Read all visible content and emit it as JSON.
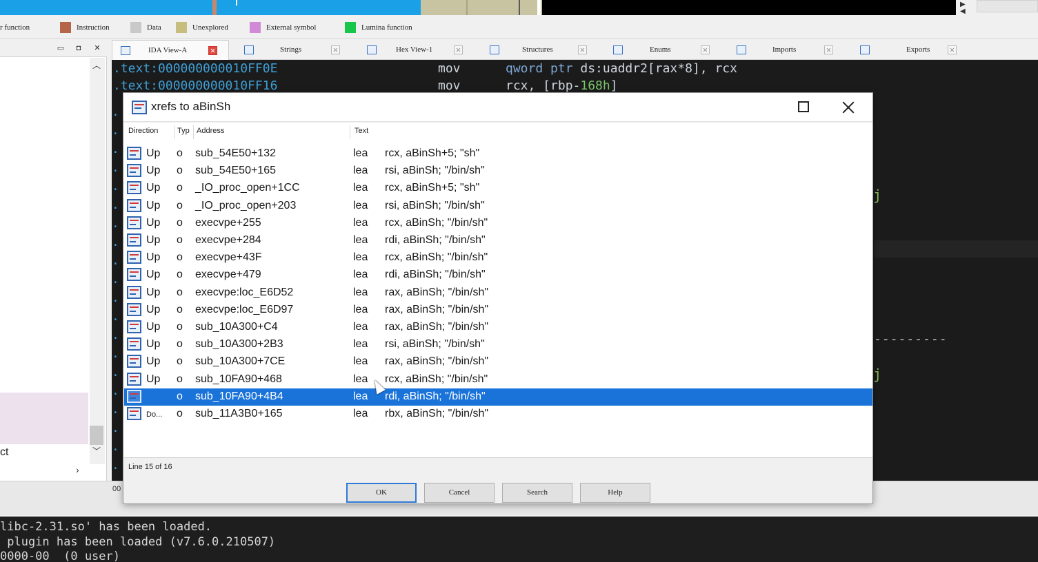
{
  "navband": {
    "segments": [
      {
        "color": "#1aa0e6"
      },
      {
        "color": "#c8c3a0"
      },
      {
        "color": "#000000"
      }
    ]
  },
  "legend": [
    {
      "label": "r function",
      "color": ""
    },
    {
      "label": "Instruction",
      "color": "#b5654a"
    },
    {
      "label": "Data",
      "color": "#c9c9c9"
    },
    {
      "label": "Unexplored",
      "color": "#c6bd7e"
    },
    {
      "label": "External symbol",
      "color": "#d08ad6"
    },
    {
      "label": "Lumina function",
      "color": "#17c64a"
    }
  ],
  "tabs": [
    {
      "label": "IDA View-A",
      "icon": "ida-view-icon",
      "active": true
    },
    {
      "label": "Strings",
      "icon": "strings-icon"
    },
    {
      "label": "Hex View-1",
      "icon": "hex-view-icon"
    },
    {
      "label": "Structures",
      "icon": "structures-icon"
    },
    {
      "label": "Enums",
      "icon": "enums-icon"
    },
    {
      "label": "Imports",
      "icon": "imports-icon"
    },
    {
      "label": "Exports",
      "icon": "exports-icon"
    }
  ],
  "left_panel": {
    "bottom_label": "ct",
    "status_fragment": "00"
  },
  "disassembly": [
    {
      "address": ".text:000000000010FF0E",
      "mnemonic": "mov",
      "operand_kw": "qword ptr",
      "operand_rest": " ds:uaddr2[rax*8], rcx",
      "operand_num": ""
    },
    {
      "address": ".text:000000000010FF16",
      "mnemonic": "mov",
      "operand_kw": "",
      "operand_rest": "rcx, [rbp-",
      "operand_num": "168h",
      "operand_tail": "]"
    }
  ],
  "dialog": {
    "title": "xrefs to aBinSh",
    "columns": [
      "Direction",
      "Typ",
      "Address",
      "Text"
    ],
    "rows": [
      {
        "dir": "Up",
        "typ": "o",
        "addr": "sub_54E50+132",
        "mn": "lea",
        "ops": "rcx, aBinSh+5; \"sh\""
      },
      {
        "dir": "Up",
        "typ": "o",
        "addr": "sub_54E50+165",
        "mn": "lea",
        "ops": "rsi, aBinSh; \"/bin/sh\""
      },
      {
        "dir": "Up",
        "typ": "o",
        "addr": "_IO_proc_open+1CC",
        "mn": "lea",
        "ops": "rcx, aBinSh+5; \"sh\""
      },
      {
        "dir": "Up",
        "typ": "o",
        "addr": "_IO_proc_open+203",
        "mn": "lea",
        "ops": "rsi, aBinSh; \"/bin/sh\""
      },
      {
        "dir": "Up",
        "typ": "o",
        "addr": "execvpe+255",
        "mn": "lea",
        "ops": "rcx, aBinSh; \"/bin/sh\""
      },
      {
        "dir": "Up",
        "typ": "o",
        "addr": "execvpe+284",
        "mn": "lea",
        "ops": "rdi, aBinSh; \"/bin/sh\""
      },
      {
        "dir": "Up",
        "typ": "o",
        "addr": "execvpe+43F",
        "mn": "lea",
        "ops": "rcx, aBinSh; \"/bin/sh\""
      },
      {
        "dir": "Up",
        "typ": "o",
        "addr": "execvpe+479",
        "mn": "lea",
        "ops": "rdi, aBinSh; \"/bin/sh\""
      },
      {
        "dir": "Up",
        "typ": "o",
        "addr": "execvpe:loc_E6D52",
        "mn": "lea",
        "ops": "rax, aBinSh; \"/bin/sh\""
      },
      {
        "dir": "Up",
        "typ": "o",
        "addr": "execvpe:loc_E6D97",
        "mn": "lea",
        "ops": "rax, aBinSh; \"/bin/sh\""
      },
      {
        "dir": "Up",
        "typ": "o",
        "addr": "sub_10A300+C4",
        "mn": "lea",
        "ops": "rax, aBinSh; \"/bin/sh\""
      },
      {
        "dir": "Up",
        "typ": "o",
        "addr": "sub_10A300+2B3",
        "mn": "lea",
        "ops": "rsi, aBinSh; \"/bin/sh\""
      },
      {
        "dir": "Up",
        "typ": "o",
        "addr": "sub_10A300+7CE",
        "mn": "lea",
        "ops": "rax, aBinSh; \"/bin/sh\""
      },
      {
        "dir": "Up",
        "typ": "o",
        "addr": "sub_10FA90+468",
        "mn": "lea",
        "ops": "rcx, aBinSh; \"/bin/sh\""
      },
      {
        "dir": "",
        "typ": "o",
        "addr": "sub_10FA90+4B4",
        "mn": "lea",
        "ops": "rdi, aBinSh; \"/bin/sh\"",
        "selected": true
      },
      {
        "dir": "Do...",
        "typ": "o",
        "addr": "sub_11A3B0+165",
        "mn": "lea",
        "ops": "rbx, aBinSh; \"/bin/sh\""
      }
    ],
    "status": "Line 15 of 16",
    "buttons": {
      "ok": "OK",
      "cancel": "Cancel",
      "search": "Search",
      "help": "Help"
    }
  },
  "output": [
    "libc-2.31.so' has been loaded.",
    " plugin has been loaded (v7.6.0.210507)",
    "0000-00  (0 user)"
  ]
}
